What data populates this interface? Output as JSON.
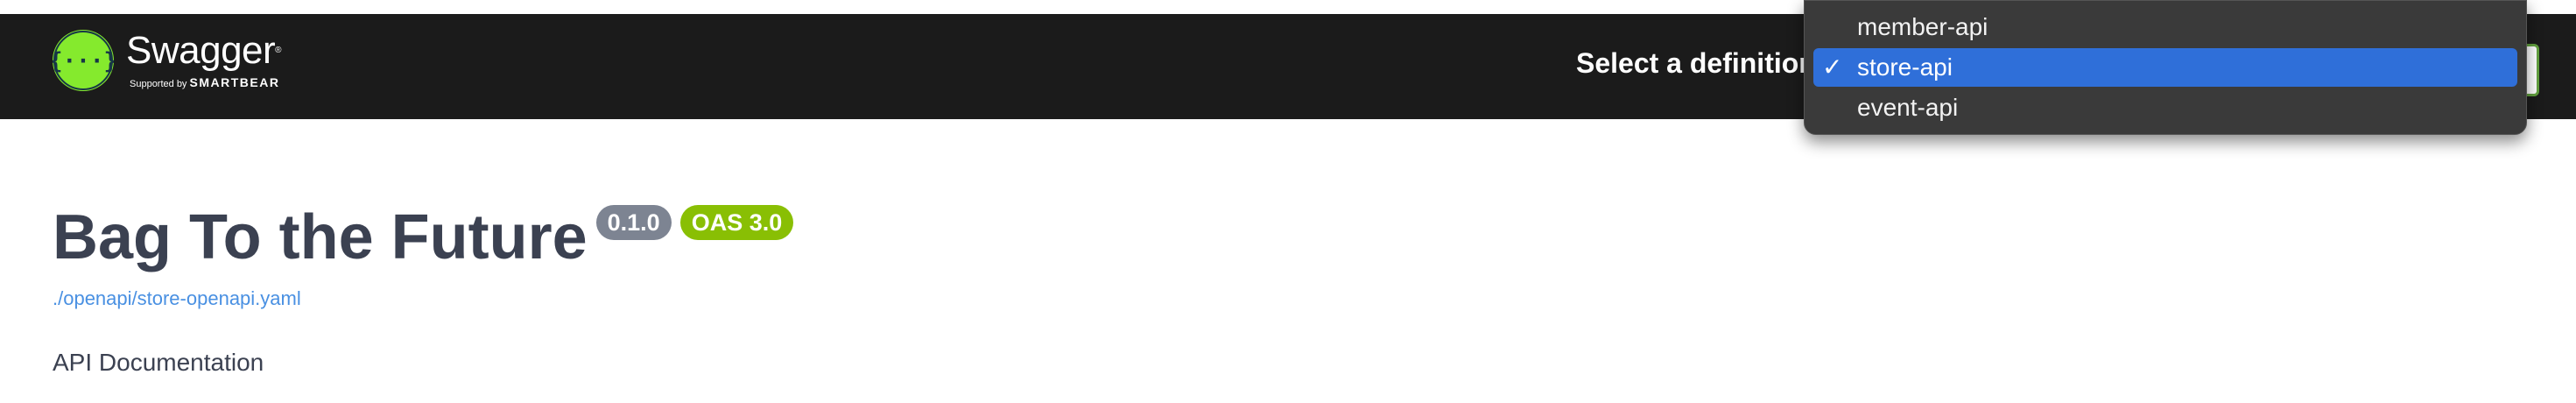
{
  "header": {
    "logo": {
      "name": "Swagger",
      "trademark": "®",
      "supported_by": "Supported by",
      "company": "SMARTBEAR",
      "icon": "swagger-braces-icon",
      "accent_color": "#85ea2d"
    },
    "definition_label": "Select a definition",
    "definition_select": {
      "options": [
        {
          "label": "member-api",
          "selected": false
        },
        {
          "label": "store-api",
          "selected": true
        },
        {
          "label": "event-api",
          "selected": false
        }
      ],
      "checkmark": "✓",
      "highlight_color": "#2f6fd9"
    }
  },
  "info": {
    "title": "Bag To the Future",
    "version_badge": "0.1.0",
    "oas_badge": "OAS 3.0",
    "spec_url": "./openapi/store-openapi.yaml",
    "description": "API Documentation"
  }
}
